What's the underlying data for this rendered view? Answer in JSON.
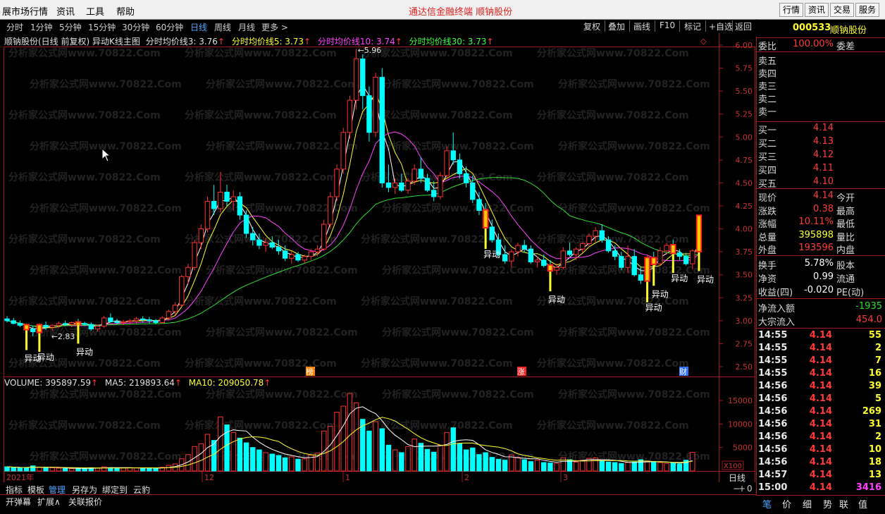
{
  "menu": {
    "items": [
      "展市场行情",
      "资讯",
      "工具",
      "帮助"
    ],
    "center_title": "通达信金融终端   顺钠股份",
    "right_buttons": [
      "行情",
      "资讯",
      "交易",
      "服务"
    ]
  },
  "toolbar": {
    "periods": [
      "分时",
      "1分钟",
      "5分钟",
      "15分钟",
      "30分钟",
      "60分钟",
      "日线",
      "周线",
      "月线",
      "更多 >"
    ],
    "active_period": "日线",
    "right_buttons": [
      "复权",
      "叠加",
      "画线",
      "F10",
      "标记",
      "+自选",
      "返回"
    ]
  },
  "chart_header": {
    "title": "顺钠股份(日线 前复权) 异动K线主图",
    "ma3": "分时均价线3: 3.76",
    "ma5": "分时均价线5: 3.73",
    "ma10": "分时均价线10: 3.74",
    "ma30": "分时均价线30: 3.73"
  },
  "volume_header": {
    "volume": "VOLUME: 395897.59",
    "ma5": "MA5: 219893.64",
    "ma10": "MA10: 209050.78"
  },
  "watermark": "分析家公式网www.70822.Com",
  "price_axis": [
    "6.00",
    "5.75",
    "5.50",
    "5.25",
    "5.00",
    "4.75",
    "4.50",
    "4.25",
    "4.00",
    "3.75",
    "3.50",
    "3.25",
    "3.00",
    "2.75",
    "2.50"
  ],
  "volume_axis": [
    "15000",
    "10000",
    "5000",
    "X100"
  ],
  "time_axis": [
    {
      "label": "2021年",
      "x": 6
    },
    {
      "label": "12",
      "x": 287
    },
    {
      "label": "1",
      "x": 487
    },
    {
      "label": "2",
      "x": 656
    },
    {
      "label": "3",
      "x": 796
    }
  ],
  "annotations": {
    "high": "5.96",
    "low": "2.83",
    "event_label": "异动",
    "markers": [
      "榜",
      "涨",
      "财"
    ]
  },
  "stock": {
    "code": "000533",
    "name": "顺钠股份"
  },
  "order_book": {
    "ratio_label": "委比",
    "ratio_value": "100.00%",
    "diff_label": "委差",
    "asks": [
      {
        "label": "卖五",
        "price": ""
      },
      {
        "label": "卖四",
        "price": ""
      },
      {
        "label": "卖三",
        "price": ""
      },
      {
        "label": "卖二",
        "price": ""
      },
      {
        "label": "卖一",
        "price": ""
      }
    ],
    "bids": [
      {
        "label": "买一",
        "price": "4.14"
      },
      {
        "label": "买二",
        "price": "4.13"
      },
      {
        "label": "买三",
        "price": "4.12"
      },
      {
        "label": "买四",
        "price": "4.11"
      },
      {
        "label": "买五",
        "price": "4.10"
      }
    ]
  },
  "quote": [
    {
      "l": "现价",
      "v": "4.14",
      "c": "red",
      "r": "今开"
    },
    {
      "l": "涨跌",
      "v": "0.38",
      "c": "red",
      "r": "最高"
    },
    {
      "l": "涨幅",
      "v": "10.11%",
      "c": "red",
      "r": "最低"
    },
    {
      "l": "总量",
      "v": "395898",
      "c": "yellow",
      "r": "量比"
    },
    {
      "l": "外盘",
      "v": "193596",
      "c": "red",
      "r": "内盘"
    }
  ],
  "fundamentals": [
    {
      "l": "换手",
      "v": "5.78%",
      "c": "white",
      "r": "股本"
    },
    {
      "l": "净资",
      "v": "0.99",
      "c": "white",
      "r": "流通"
    },
    {
      "l": "收益(四)",
      "v": "-0.020",
      "c": "white",
      "r": "PE(动)"
    }
  ],
  "flows": [
    {
      "l": "净流入额",
      "v": "-1935",
      "c": "green"
    },
    {
      "l": "大宗流入",
      "v": "454.0",
      "c": "red"
    }
  ],
  "ticks": [
    {
      "t": "14:55",
      "p": "4.14",
      "v": "55",
      "c": "yellow"
    },
    {
      "t": "14:55",
      "p": "4.14",
      "v": "2",
      "c": "yellow"
    },
    {
      "t": "14:55",
      "p": "4.14",
      "v": "7",
      "c": "yellow"
    },
    {
      "t": "14:55",
      "p": "4.14",
      "v": "16",
      "c": "yellow"
    },
    {
      "t": "14:56",
      "p": "4.14",
      "v": "39",
      "c": "yellow"
    },
    {
      "t": "14:56",
      "p": "4.14",
      "v": "5",
      "c": "yellow"
    },
    {
      "t": "14:56",
      "p": "4.14",
      "v": "269",
      "c": "yellow"
    },
    {
      "t": "14:56",
      "p": "4.14",
      "v": "31",
      "c": "yellow"
    },
    {
      "t": "14:56",
      "p": "4.14",
      "v": "2",
      "c": "yellow"
    },
    {
      "t": "14:56",
      "p": "4.14",
      "v": "10",
      "c": "yellow"
    },
    {
      "t": "14:56",
      "p": "4.14",
      "v": "18",
      "c": "yellow"
    },
    {
      "t": "14:57",
      "p": "4.14",
      "v": "13",
      "c": "yellow"
    },
    {
      "t": "15:00",
      "p": "4.14",
      "v": "3416",
      "c": "purple"
    }
  ],
  "bottom_tabs": [
    "指标",
    "模板",
    "管理",
    "另存为",
    "绑定到",
    "云豹"
  ],
  "bottom_tabs2": [
    "开弹幕",
    "扩展∧",
    "关联报价"
  ],
  "period_label": "日线",
  "right_tabs": [
    "笔",
    "价",
    "细",
    "势",
    "联",
    "值"
  ],
  "chart_data": {
    "type": "candlestick",
    "title": "顺钠股份(日线 前复权)",
    "ylim": [
      2.5,
      6.0
    ],
    "ohlc": [
      [
        3.02,
        3.05,
        2.98,
        3.0
      ],
      [
        3.0,
        3.03,
        2.96,
        2.97
      ],
      [
        2.97,
        3.0,
        2.93,
        2.95
      ],
      [
        2.95,
        2.97,
        2.88,
        2.91
      ],
      [
        2.91,
        2.94,
        2.83,
        2.88
      ],
      [
        2.88,
        2.97,
        2.86,
        2.95
      ],
      [
        2.95,
        2.99,
        2.9,
        2.93
      ],
      [
        2.93,
        2.96,
        2.89,
        2.95
      ],
      [
        2.95,
        2.99,
        2.92,
        2.97
      ],
      [
        2.97,
        3.0,
        2.94,
        2.96
      ],
      [
        2.96,
        2.99,
        2.93,
        2.98
      ],
      [
        2.98,
        3.02,
        2.95,
        2.97
      ],
      [
        2.97,
        2.99,
        2.94,
        2.96
      ],
      [
        2.96,
        2.98,
        2.89,
        2.91
      ],
      [
        2.91,
        2.95,
        2.88,
        2.94
      ],
      [
        2.94,
        3.05,
        2.92,
        3.03
      ],
      [
        3.03,
        3.08,
        2.98,
        2.99
      ],
      [
        2.99,
        3.02,
        2.96,
        2.98
      ],
      [
        2.98,
        3.01,
        2.95,
        2.99
      ],
      [
        2.99,
        3.02,
        2.96,
        3.0
      ],
      [
        3.0,
        3.04,
        2.97,
        3.02
      ],
      [
        3.02,
        3.05,
        2.98,
        3.01
      ],
      [
        3.01,
        3.04,
        2.97,
        3.0
      ],
      [
        3.0,
        3.02,
        2.96,
        2.98
      ],
      [
        2.98,
        3.05,
        2.97,
        3.03
      ],
      [
        3.03,
        3.12,
        3.01,
        3.1
      ],
      [
        3.1,
        3.2,
        3.06,
        3.17
      ],
      [
        3.17,
        3.5,
        3.15,
        3.48
      ],
      [
        3.48,
        3.62,
        3.4,
        3.58
      ],
      [
        3.58,
        3.88,
        3.55,
        3.85
      ],
      [
        3.85,
        4.05,
        3.78,
        4.0
      ],
      [
        4.0,
        4.35,
        3.96,
        4.3
      ],
      [
        4.3,
        4.48,
        4.15,
        4.22
      ],
      [
        4.22,
        4.62,
        4.18,
        4.4
      ],
      [
        4.4,
        4.48,
        4.25,
        4.3
      ],
      [
        4.3,
        4.42,
        4.2,
        4.35
      ],
      [
        4.35,
        4.4,
        4.1,
        4.15
      ],
      [
        4.15,
        4.2,
        3.9,
        3.95
      ],
      [
        3.95,
        4.02,
        3.82,
        3.88
      ],
      [
        3.88,
        3.95,
        3.78,
        3.82
      ],
      [
        3.82,
        3.9,
        3.75,
        3.85
      ],
      [
        3.85,
        3.92,
        3.78,
        3.8
      ],
      [
        3.8,
        3.88,
        3.72,
        3.76
      ],
      [
        3.76,
        3.82,
        3.65,
        3.68
      ],
      [
        3.68,
        3.76,
        3.62,
        3.72
      ],
      [
        3.72,
        3.75,
        3.64,
        3.66
      ],
      [
        3.66,
        3.72,
        3.62,
        3.7
      ],
      [
        3.7,
        3.78,
        3.66,
        3.75
      ],
      [
        3.75,
        3.82,
        3.7,
        3.78
      ],
      [
        3.78,
        4.1,
        3.76,
        4.05
      ],
      [
        4.05,
        4.4,
        4.0,
        4.35
      ],
      [
        4.35,
        4.7,
        4.3,
        4.65
      ],
      [
        4.65,
        5.1,
        4.6,
        5.05
      ],
      [
        5.05,
        5.45,
        4.98,
        5.4
      ],
      [
        5.4,
        5.96,
        5.3,
        5.85
      ],
      [
        5.85,
        5.9,
        5.3,
        5.45
      ],
      [
        5.45,
        5.55,
        4.95,
        5.05
      ],
      [
        5.05,
        5.7,
        5.0,
        5.65
      ],
      [
        5.65,
        5.75,
        4.45,
        4.5
      ],
      [
        4.5,
        4.7,
        4.4,
        4.45
      ],
      [
        4.45,
        4.55,
        4.38,
        4.5
      ],
      [
        4.5,
        4.6,
        4.4,
        4.42
      ],
      [
        4.42,
        4.55,
        4.38,
        4.52
      ],
      [
        4.52,
        4.7,
        4.48,
        4.65
      ],
      [
        4.65,
        4.78,
        4.5,
        4.55
      ],
      [
        4.55,
        4.6,
        4.4,
        4.42
      ],
      [
        4.42,
        4.52,
        4.3,
        4.35
      ],
      [
        4.35,
        4.62,
        4.32,
        4.58
      ],
      [
        4.58,
        4.9,
        4.55,
        4.85
      ],
      [
        4.85,
        5.05,
        4.7,
        4.75
      ],
      [
        4.75,
        4.82,
        4.55,
        4.6
      ],
      [
        4.6,
        4.68,
        4.45,
        4.5
      ],
      [
        4.5,
        4.58,
        4.28,
        4.32
      ],
      [
        4.32,
        4.4,
        4.15,
        4.2
      ],
      [
        4.2,
        4.28,
        3.98,
        4.02
      ],
      [
        4.02,
        4.1,
        3.85,
        3.88
      ],
      [
        3.88,
        3.95,
        3.7,
        3.72
      ],
      [
        3.72,
        3.82,
        3.62,
        3.65
      ],
      [
        3.65,
        3.78,
        3.58,
        3.75
      ],
      [
        3.75,
        3.85,
        3.7,
        3.82
      ],
      [
        3.82,
        3.88,
        3.74,
        3.78
      ],
      [
        3.78,
        3.82,
        3.62,
        3.64
      ],
      [
        3.64,
        3.7,
        3.58,
        3.66
      ],
      [
        3.66,
        3.72,
        3.58,
        3.6
      ],
      [
        3.6,
        3.66,
        3.52,
        3.55
      ],
      [
        3.55,
        3.62,
        3.5,
        3.58
      ],
      [
        3.58,
        3.8,
        3.56,
        3.76
      ],
      [
        3.76,
        3.85,
        3.7,
        3.72
      ],
      [
        3.72,
        3.8,
        3.66,
        3.78
      ],
      [
        3.78,
        3.86,
        3.74,
        3.84
      ],
      [
        3.84,
        3.95,
        3.8,
        3.92
      ],
      [
        3.92,
        4.02,
        3.86,
        3.98
      ],
      [
        3.98,
        4.05,
        3.85,
        3.88
      ],
      [
        3.88,
        3.92,
        3.74,
        3.76
      ],
      [
        3.76,
        3.82,
        3.66,
        3.7
      ],
      [
        3.7,
        3.75,
        3.55,
        3.58
      ],
      [
        3.58,
        3.82,
        3.52,
        3.7
      ],
      [
        3.7,
        3.78,
        3.48,
        3.5
      ],
      [
        3.5,
        3.58,
        3.4,
        3.44
      ],
      [
        3.44,
        3.72,
        3.4,
        3.68
      ],
      [
        3.68,
        3.75,
        3.58,
        3.62
      ],
      [
        3.62,
        3.8,
        3.6,
        3.76
      ],
      [
        3.76,
        3.85,
        3.72,
        3.82
      ],
      [
        3.82,
        3.88,
        3.72,
        3.74
      ],
      [
        3.74,
        3.78,
        3.66,
        3.7
      ],
      [
        3.7,
        3.74,
        3.6,
        3.62
      ],
      [
        3.62,
        3.78,
        3.56,
        3.76
      ],
      [
        3.76,
        4.14,
        3.74,
        4.14
      ]
    ],
    "volume_x100": [
      900,
      750,
      650,
      700,
      1100,
      800,
      650,
      700,
      600,
      550,
      500,
      600,
      550,
      700,
      650,
      900,
      700,
      600,
      650,
      700,
      650,
      600,
      550,
      600,
      800,
      1200,
      1500,
      2600,
      3500,
      5200,
      5800,
      7800,
      6500,
      11500,
      9800,
      8200,
      7000,
      6000,
      5000,
      4500,
      3900,
      3600,
      3300,
      2800,
      3000,
      2500,
      2600,
      3400,
      3800,
      8500,
      9500,
      12500,
      13800,
      16500,
      14500,
      11000,
      8500,
      10500,
      9000,
      5500,
      4500,
      3900,
      5200,
      6800,
      5900,
      4600,
      4000,
      5500,
      8200,
      9200,
      5800,
      4500,
      4900,
      3500,
      3900,
      2900,
      2500,
      2300,
      3400,
      2900,
      2400,
      2000,
      2300,
      1800,
      1700,
      1600,
      2800,
      2400,
      1900,
      2300,
      2700,
      2800,
      2200,
      1900,
      1800,
      1600,
      1800,
      1900,
      2400,
      2000,
      1900,
      1800,
      1600,
      1700,
      1500,
      2300,
      3959
    ]
  }
}
